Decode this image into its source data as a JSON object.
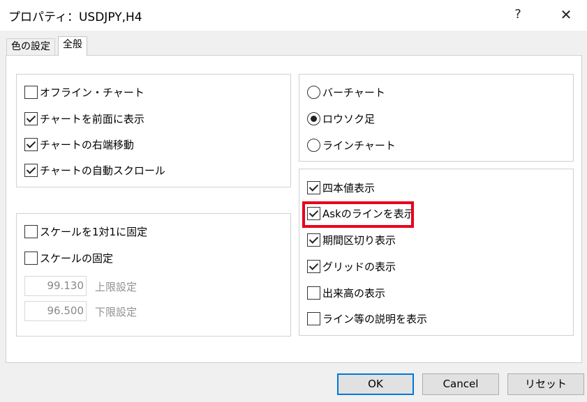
{
  "window": {
    "title": "プロパティ：USDJPY,H4",
    "help_label": "?",
    "close_label": "✕"
  },
  "tabs": [
    {
      "label": "色の設定",
      "active": false
    },
    {
      "label": "全般",
      "active": true
    }
  ],
  "chart_options": [
    {
      "label": "オフライン・チャート",
      "checked": false
    },
    {
      "label": "チャートを前面に表示",
      "checked": true
    },
    {
      "label": "チャートの右端移動",
      "checked": true
    },
    {
      "label": "チャートの自動スクロール",
      "checked": true
    }
  ],
  "scale_options": [
    {
      "label": "スケールを1対1に固定",
      "checked": false
    },
    {
      "label": "スケールの固定",
      "checked": false
    }
  ],
  "scale_fields": {
    "upper_value": "99.130",
    "upper_label": "上限設定",
    "lower_value": "96.500",
    "lower_label": "下限設定"
  },
  "chart_types": [
    {
      "label": "バーチャート",
      "selected": false
    },
    {
      "label": "ロウソク足",
      "selected": true
    },
    {
      "label": "ラインチャート",
      "selected": false
    }
  ],
  "display_options": [
    {
      "label": "四本値表示",
      "checked": true
    },
    {
      "label": "Askのラインを表示",
      "checked": true
    },
    {
      "label": "期間区切り表示",
      "checked": true
    },
    {
      "label": "グリッドの表示",
      "checked": true
    },
    {
      "label": "出来高の表示",
      "checked": false
    },
    {
      "label": "ライン等の説明を表示",
      "checked": false
    }
  ],
  "highlight_color": "#e8001c",
  "buttons": {
    "ok": "OK",
    "cancel": "Cancel",
    "reset": "リセット"
  }
}
